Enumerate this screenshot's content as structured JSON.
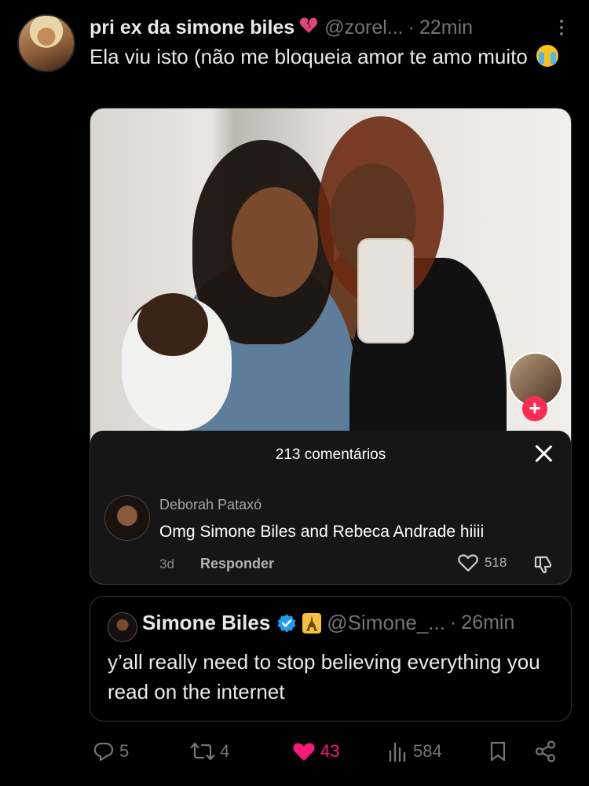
{
  "tweet": {
    "display_name": "pri ex da simone biles",
    "handle": "@zorel...",
    "separator": "·",
    "time": "22min",
    "text": "Ela viu isto (não me bloqueia amor te amo muito"
  },
  "media": {
    "comments_count": "213 comentários",
    "comment": {
      "author": "Deborah Pataxó",
      "text": "Omg Simone Biles and Rebeca Andrade hiiii",
      "age": "3d",
      "reply_label": "Responder",
      "likes": "518"
    },
    "follow_label": "+"
  },
  "quote": {
    "display_name": "Simone Biles",
    "handle": "@Simone_...",
    "separator": "·",
    "time": "26min",
    "text": "y’all really need to stop believing everything you read on the internet"
  },
  "actions": {
    "replies": "5",
    "reposts": "4",
    "likes": "43",
    "views": "584"
  },
  "colors": {
    "like_pink": "#f91880",
    "verified_blue": "#1d9bf0",
    "muted": "#71767b",
    "follow_red": "#fe2c55"
  }
}
